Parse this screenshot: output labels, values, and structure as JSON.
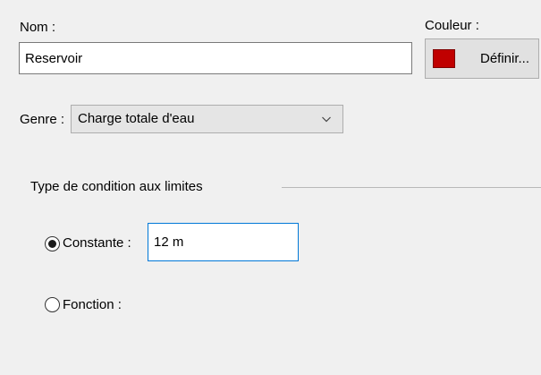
{
  "name_field": {
    "label": "Nom :",
    "value": "Reservoir"
  },
  "color": {
    "label": "Couleur :",
    "swatch_color": "#c00000",
    "define_button_label": "Définir..."
  },
  "genre": {
    "label": "Genre :",
    "selected": "Charge totale d'eau",
    "icon": "chevron-down-icon"
  },
  "boundary_condition": {
    "group_title": "Type de condition aux limites",
    "options": [
      {
        "label": "Constante :",
        "checked": true
      },
      {
        "label": "Fonction :",
        "checked": false
      }
    ],
    "constant_value": "12 m"
  }
}
